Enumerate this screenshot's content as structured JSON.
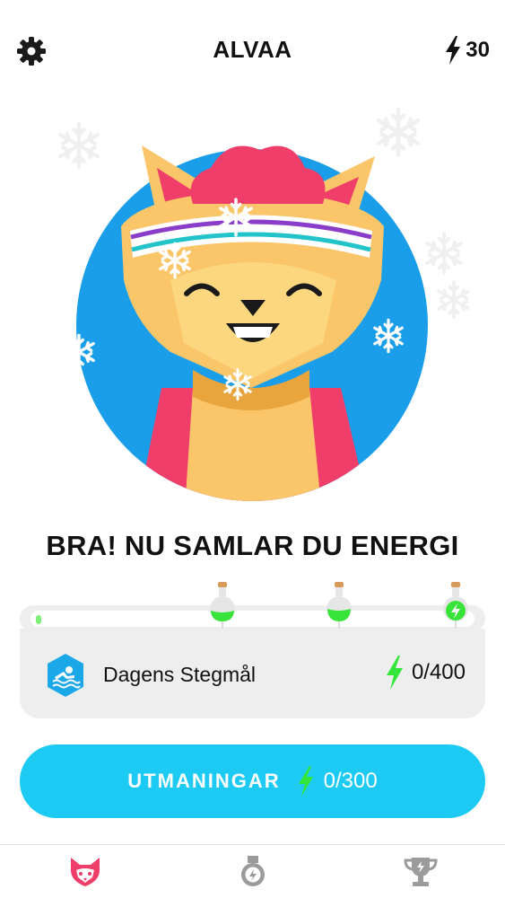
{
  "header": {
    "title": "ALVAA",
    "energy_count": "30",
    "settings_icon": "gear-icon",
    "energy_icon": "lightning-icon"
  },
  "hero": {
    "character": "fox-avatar",
    "decoration": "snowflake-icon"
  },
  "headline": "BRA! NU SAMLAR DU ENERGI",
  "progress": {
    "level": 0.01,
    "milestones": [
      "potion-bottle-icon",
      "potion-bottle-icon",
      "potion-bottle-energy-icon"
    ]
  },
  "daily_goal": {
    "icon": "swimmer-icon",
    "label": "Dagens Stegmål",
    "value": "0/400",
    "value_icon": "lightning-icon"
  },
  "challenges_button": {
    "label": "UTMANINGAR",
    "value": "0/300",
    "value_icon": "lightning-icon"
  },
  "tabs": [
    {
      "icon": "fox-icon",
      "active": true
    },
    {
      "icon": "medal-icon",
      "active": false
    },
    {
      "icon": "trophy-icon",
      "active": false
    }
  ],
  "colors": {
    "accent_blue": "#1ccaf3",
    "avatar_circle": "#1a9ee9",
    "energy_green": "#34e63a",
    "fox_orange": "#fbc66a",
    "fox_pink": "#ef3e6a",
    "tab_active": "#ef3e6a",
    "tab_inactive": "#9b9b9b"
  }
}
